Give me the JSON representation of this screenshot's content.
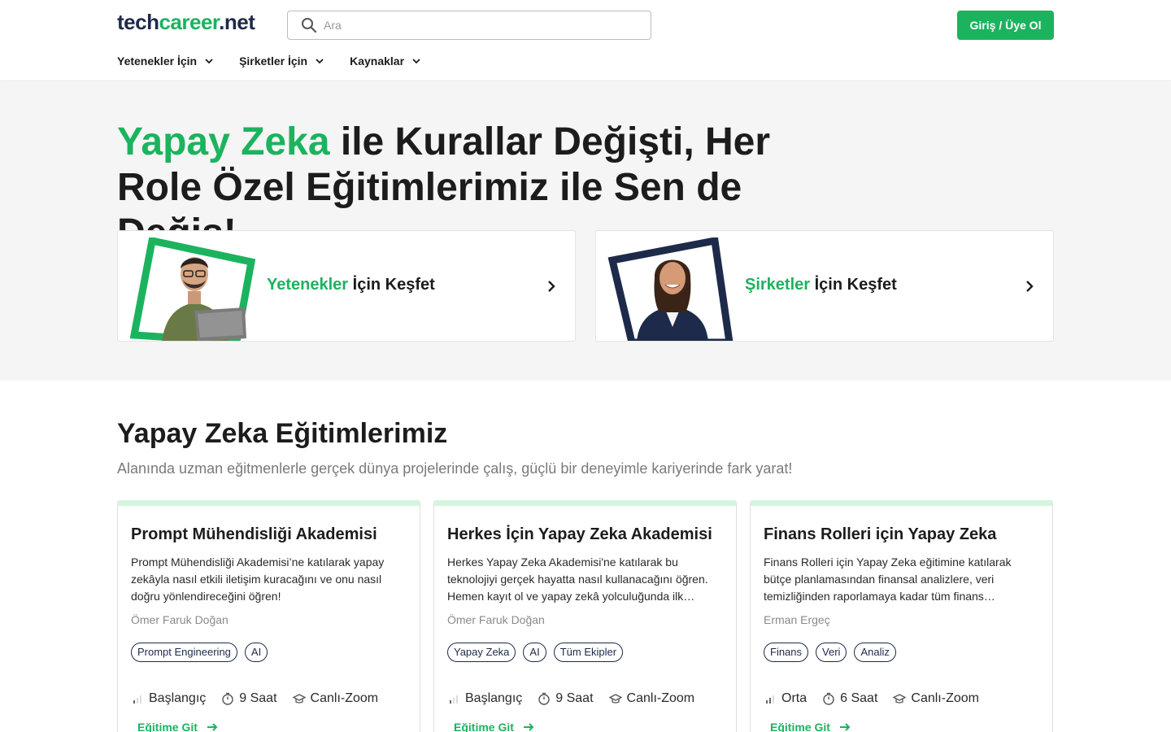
{
  "header": {
    "logo_prefix": "tech",
    "logo_middle": "career",
    "logo_suffix": ".net",
    "search_placeholder": "Ara",
    "login_label": "Giriş / Üye Ol",
    "nav": [
      "Yetenekler İçin",
      "Şirketler İçin",
      "Kaynaklar"
    ]
  },
  "hero": {
    "title_highlight": "Yapay Zeka",
    "title_rest": " ile Kurallar Değişti, Her Role Özel Eğitimlerimiz ile Sen de Değiş!",
    "cards": [
      {
        "highlight": "Yetenekler",
        "rest": " İçin Keşfet"
      },
      {
        "highlight": "Şirketler",
        "rest": " İçin Keşfet"
      }
    ]
  },
  "section": {
    "title": "Yapay Zeka Eğitimlerimiz",
    "subtitle": "Alanında uzman eğitmenlerle gerçek dünya projelerinde çalış, güçlü bir deneyimle kariyerinde fark yarat!"
  },
  "courses": [
    {
      "title": "Prompt Mühendisliği Akademisi",
      "desc": "Prompt Mühendisliği Akademisi’ne katılarak yapay zekâyla nasıl etkili iletişim kuracağını ve onu nasıl doğru yönlendireceğini öğren!",
      "author": "Ömer Faruk Doğan",
      "tags": [
        "Prompt Engineering",
        "AI"
      ],
      "level": "Başlangıç",
      "duration": "9 Saat",
      "format": "Canlı-Zoom",
      "cta": "Eğitime Git"
    },
    {
      "title": "Herkes İçin Yapay Zeka Akademisi",
      "desc": "Herkes Yapay Zeka Akademisi'ne katılarak bu teknolojiyi gerçek hayatta nasıl kullanacağını öğren. Hemen kayıt ol ve yapay zekâ yolculuğunda ilk…",
      "author": "Ömer Faruk Doğan",
      "tags": [
        "Yapay Zeka",
        "AI",
        "Tüm Ekipler"
      ],
      "level": "Başlangıç",
      "duration": "9 Saat",
      "format": "Canlı-Zoom",
      "cta": "Eğitime Git"
    },
    {
      "title": "Finans Rolleri için Yapay Zeka",
      "desc": "Finans Rolleri için Yapay Zeka eğitimine katılarak bütçe planlamasından finansal analizlere, veri temizliğinden raporlamaya kadar tüm finans…",
      "author": "Erman Ergeç",
      "tags": [
        "Finans",
        "Veri",
        "Analiz"
      ],
      "level": "Orta",
      "duration": "6 Saat",
      "format": "Canlı-Zoom",
      "cta": "Eğitime Git"
    }
  ],
  "colors": {
    "accent": "#1cb35f",
    "navy": "#1e2a4a",
    "hero_bg": "#f5f5f5",
    "card_top": "#d4f5df"
  }
}
